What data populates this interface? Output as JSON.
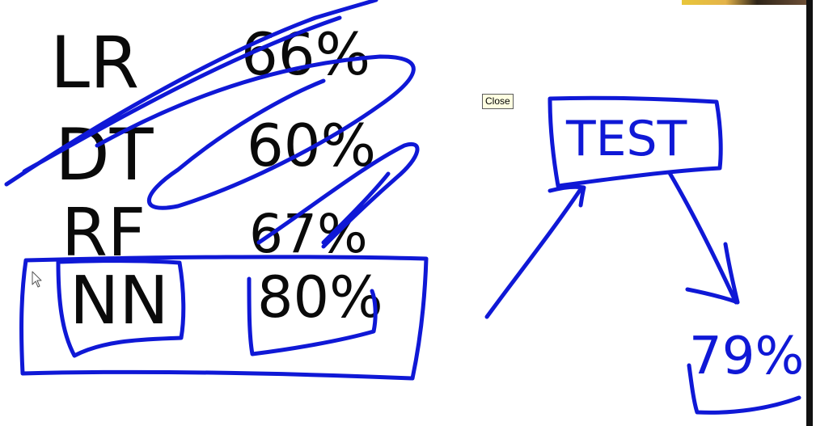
{
  "whiteboard": {
    "rows": [
      {
        "model": "LR",
        "score": "66%"
      },
      {
        "model": "DT",
        "score": "60%"
      },
      {
        "model": "RF",
        "score": "67%"
      },
      {
        "model": "NN",
        "score": "80%"
      }
    ],
    "test_box_label": "TEST",
    "test_result": "79%",
    "ink_colors": {
      "dark": "#0a0a0a",
      "blue": "#0f18d6"
    }
  },
  "tooltip": {
    "label": "Close"
  },
  "cursor": {
    "icon": "arrow-cursor-icon"
  }
}
